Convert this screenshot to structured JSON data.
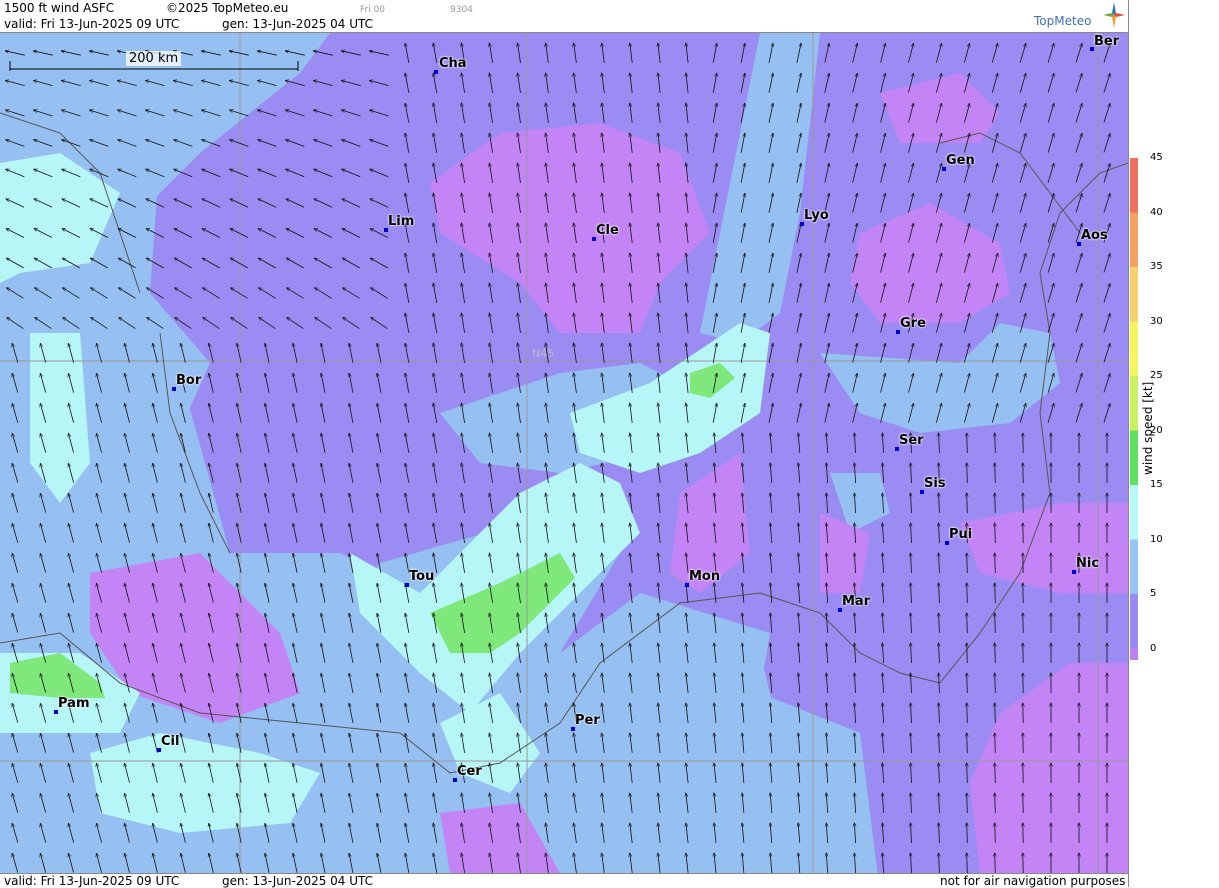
{
  "header": {
    "product": "1500 ft wind ASFC",
    "copyright": "©2025 TopMeteo.eu",
    "run": "Fri 00",
    "code": "9304",
    "valid": "valid:  Fri  13-Jun-2025  09 UTC",
    "gen": "gen: 13-Jun-2025 04 UTC",
    "brand": "TopMeteo"
  },
  "footer": {
    "valid": "valid:  Fri  13-Jun-2025  09 UTC",
    "gen": "gen: 13-Jun-2025 04 UTC",
    "disclaimer": "not for air navigation purposes"
  },
  "scale": {
    "label": "200 km"
  },
  "grid": {
    "lat_label": "N45"
  },
  "colorbar": {
    "title": "wind  speed  [kt]",
    "unit": "kt",
    "ticks": [
      "45",
      "40",
      "35",
      "30",
      "25",
      "20",
      "15",
      "10",
      "5",
      "0"
    ],
    "colors": [
      "#f07060",
      "#f4a060",
      "#f5d070",
      "#f5f560",
      "#c8f060",
      "#60e060",
      "#b8f8f8",
      "#98c4f4",
      "#9a8af0",
      "#c080f0"
    ]
  },
  "palette": {
    "lt5": "#c384f5",
    "b5_10": "#9a8cf2",
    "b10_15": "#96bff2",
    "b15_20": "#b6f6f6",
    "b20_25": "#7ee87a"
  },
  "cities": [
    {
      "name": "Cha"
    },
    {
      "name": "Ber"
    },
    {
      "name": "Gen"
    },
    {
      "name": "Lim"
    },
    {
      "name": "Cle"
    },
    {
      "name": "Lyo"
    },
    {
      "name": "Aos"
    },
    {
      "name": "Gre"
    },
    {
      "name": "Bor"
    },
    {
      "name": "Ser"
    },
    {
      "name": "Sis"
    },
    {
      "name": "Pui"
    },
    {
      "name": "Tou"
    },
    {
      "name": "Mon"
    },
    {
      "name": "Nic"
    },
    {
      "name": "Mar"
    },
    {
      "name": "Pam"
    },
    {
      "name": "Per"
    },
    {
      "name": "Cil"
    },
    {
      "name": "Cer"
    }
  ]
}
